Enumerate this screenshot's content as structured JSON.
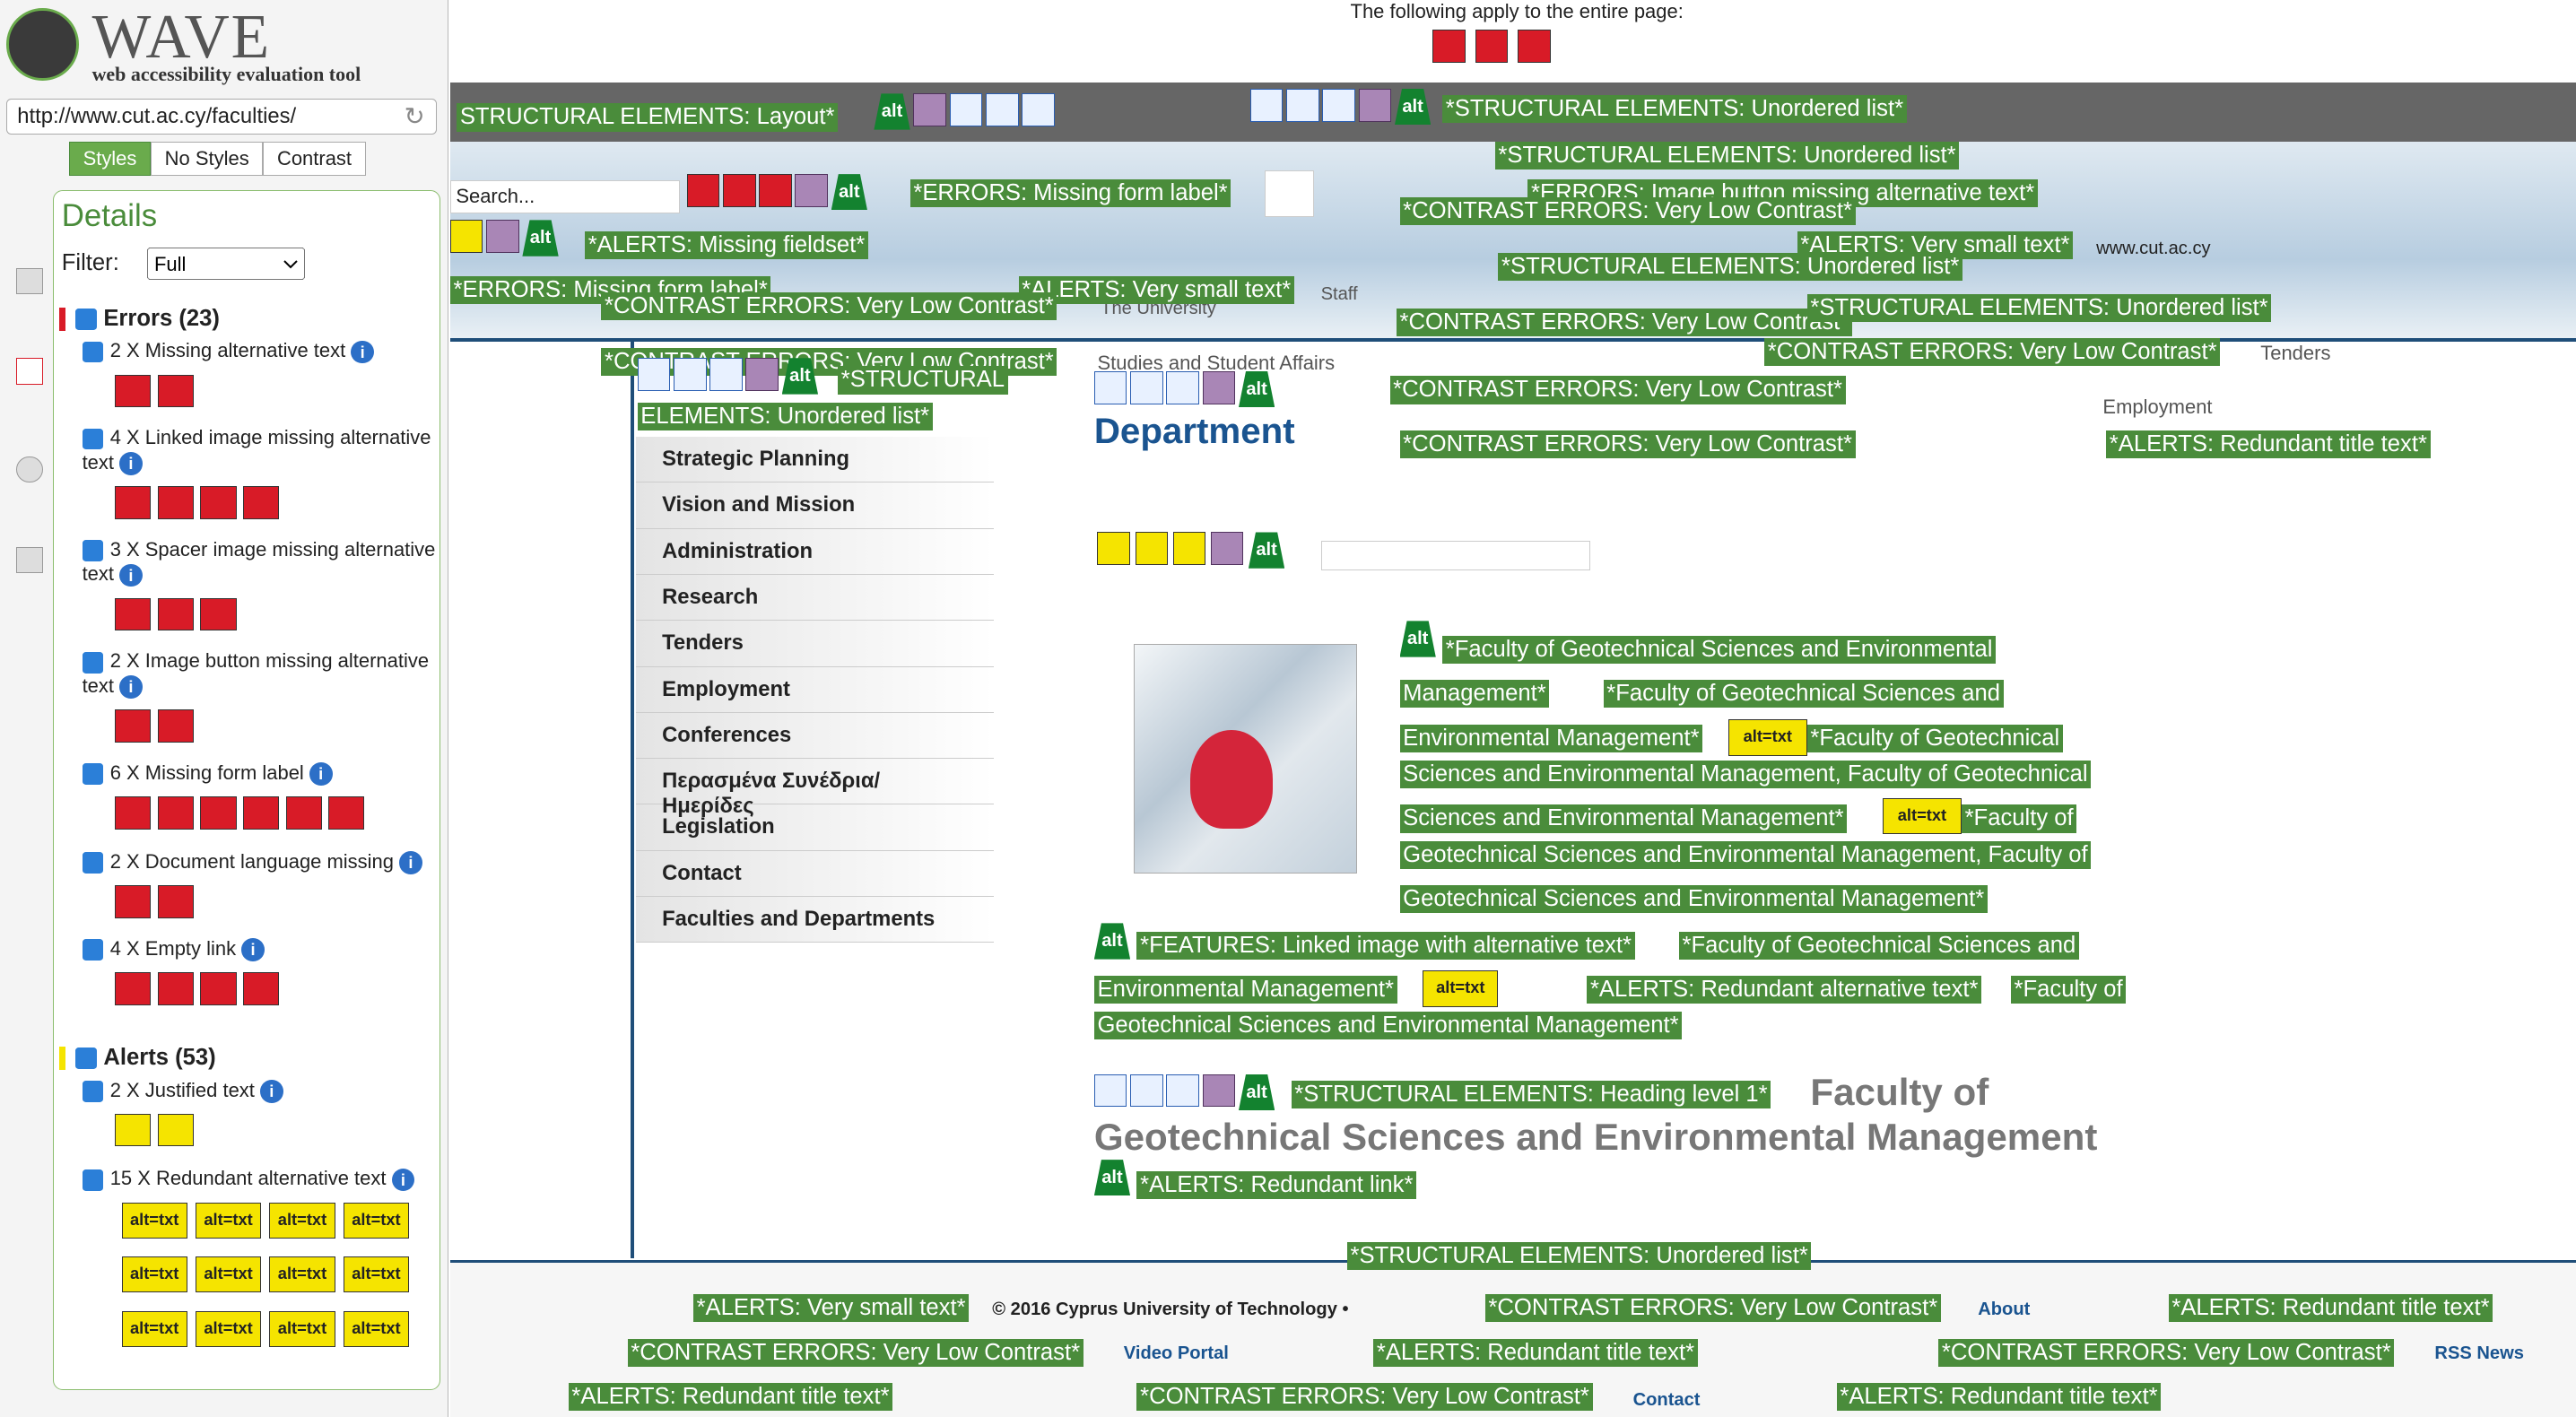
{
  "tool": {
    "name": "WAVE",
    "tagline": "web accessibility evaluation tool",
    "url": "http://www.cut.ac.cy/faculties/"
  },
  "tabs": [
    "Styles",
    "No Styles",
    "Contrast"
  ],
  "details": {
    "title": "Details",
    "filter_label": "Filter:",
    "filter_value": "Full"
  },
  "errors": {
    "label": "Errors (23)",
    "items": [
      {
        "text": "2 X Missing alternative text",
        "count": 2
      },
      {
        "text": "4 X Linked image missing alternative text",
        "count": 4
      },
      {
        "text": "3 X Spacer image missing alternative text",
        "count": 3
      },
      {
        "text": "2 X Image button missing alternative text",
        "count": 2
      },
      {
        "text": "6 X Missing form label",
        "count": 6
      },
      {
        "text": "2 X Document language missing",
        "count": 2
      },
      {
        "text": "4 X Empty link",
        "count": 4
      }
    ]
  },
  "alerts": {
    "label": "Alerts (53)",
    "items": [
      {
        "text": "2 X Justified text",
        "count": 2
      },
      {
        "text": "15 X Redundant alternative text",
        "count": 15
      }
    ]
  },
  "alt_icon": "alt=txt",
  "page": {
    "entire_page_note": "The following apply to the entire page:",
    "search_placeholder": "Search...",
    "menu": [
      "Strategic Planning",
      "Vision and Mission",
      "Administration",
      "Research",
      "Tenders",
      "Employment",
      "Conferences",
      "Περασμένα Συνέδρια/Ημερίδες",
      "Legislation",
      "Contact",
      "Faculties and Departments"
    ],
    "dept_heading": "Department",
    "heading_title_1": "Faculty of",
    "heading_title_2": "Geotechnical Sciences and Environmental Management",
    "side_texts": {
      "tenders": "Tenders",
      "employment": "Employment",
      "studies": "Studies and Student Affairs",
      "university": "The University",
      "url_small": "www.cut.ac.cy",
      "staff": "Staff"
    },
    "footer": {
      "copyright": "© 2016 Cyprus University of Technology •",
      "about": "About",
      "video": "Video Portal",
      "rss": "RSS News",
      "contact": "Contact"
    }
  },
  "overlays": {
    "layout": "STRUCTURAL ELEMENTS: Layout*",
    "ul1": "*STRUCTURAL ELEMENTS: Unordered list*",
    "missing_form_label": "*ERRORS: Missing form label*",
    "image_button": "*ERRORS: Image button missing alternative text*",
    "contrast": "*CONTRAST ERRORS: Very Low Contrast*",
    "missing_fieldset": "*ALERTS: Missing fieldset*",
    "small_text": "*ALERTS: Very small text*",
    "redundant_title": "*ALERTS: Redundant title text*",
    "ul_split_1": "*STRUCTURAL",
    "ul_split_2": "ELEMENTS: Unordered list*",
    "faculty_alt_1": "*Faculty of Geotechnical Sciences and Environmental",
    "faculty_alt_1b": "Management*",
    "faculty_alt_2": "*Faculty of Geotechnical Sciences and",
    "faculty_alt_2b": "Environmental Management*",
    "faculty_alt_3": "*Faculty of Geotechnical",
    "faculty_alt_3b": "Sciences and Environmental Management, Faculty of Geotechnical",
    "faculty_alt_3c": "Sciences and Environmental Management*",
    "faculty_alt_4": "*Faculty of",
    "faculty_alt_4b": "Geotechnical Sciences and Environmental Management, Faculty of",
    "faculty_alt_4c": "Geotechnical Sciences and Environmental Management*",
    "feature_linked": "*FEATURES: Linked image with alternative text*",
    "feature_linked_tail": "*Faculty of Geotechnical Sciences and",
    "feature_linked_b": "Environmental Management*",
    "redundant_alt": "*ALERTS: Redundant alternative text*",
    "redundant_alt_tail": "*Faculty of",
    "redundant_alt_c": "Geotechnical Sciences and Environmental Management*",
    "heading1": "*STRUCTURAL ELEMENTS: Heading level 1*",
    "redundant_link": "*ALERTS: Redundant link*",
    "contrast_f": "*CONTRAST ERRORS: Very Low Contrast*",
    "ul_bottom": "*STRUCTURAL ELEMENTS: Unordered list*"
  },
  "colors": {
    "error": "#d81b27",
    "alert": "#f5e400",
    "structure": "#2c6fc7",
    "feature": "#13822f",
    "overlay": "#4a8c3b",
    "accent": "#6aab4c"
  }
}
